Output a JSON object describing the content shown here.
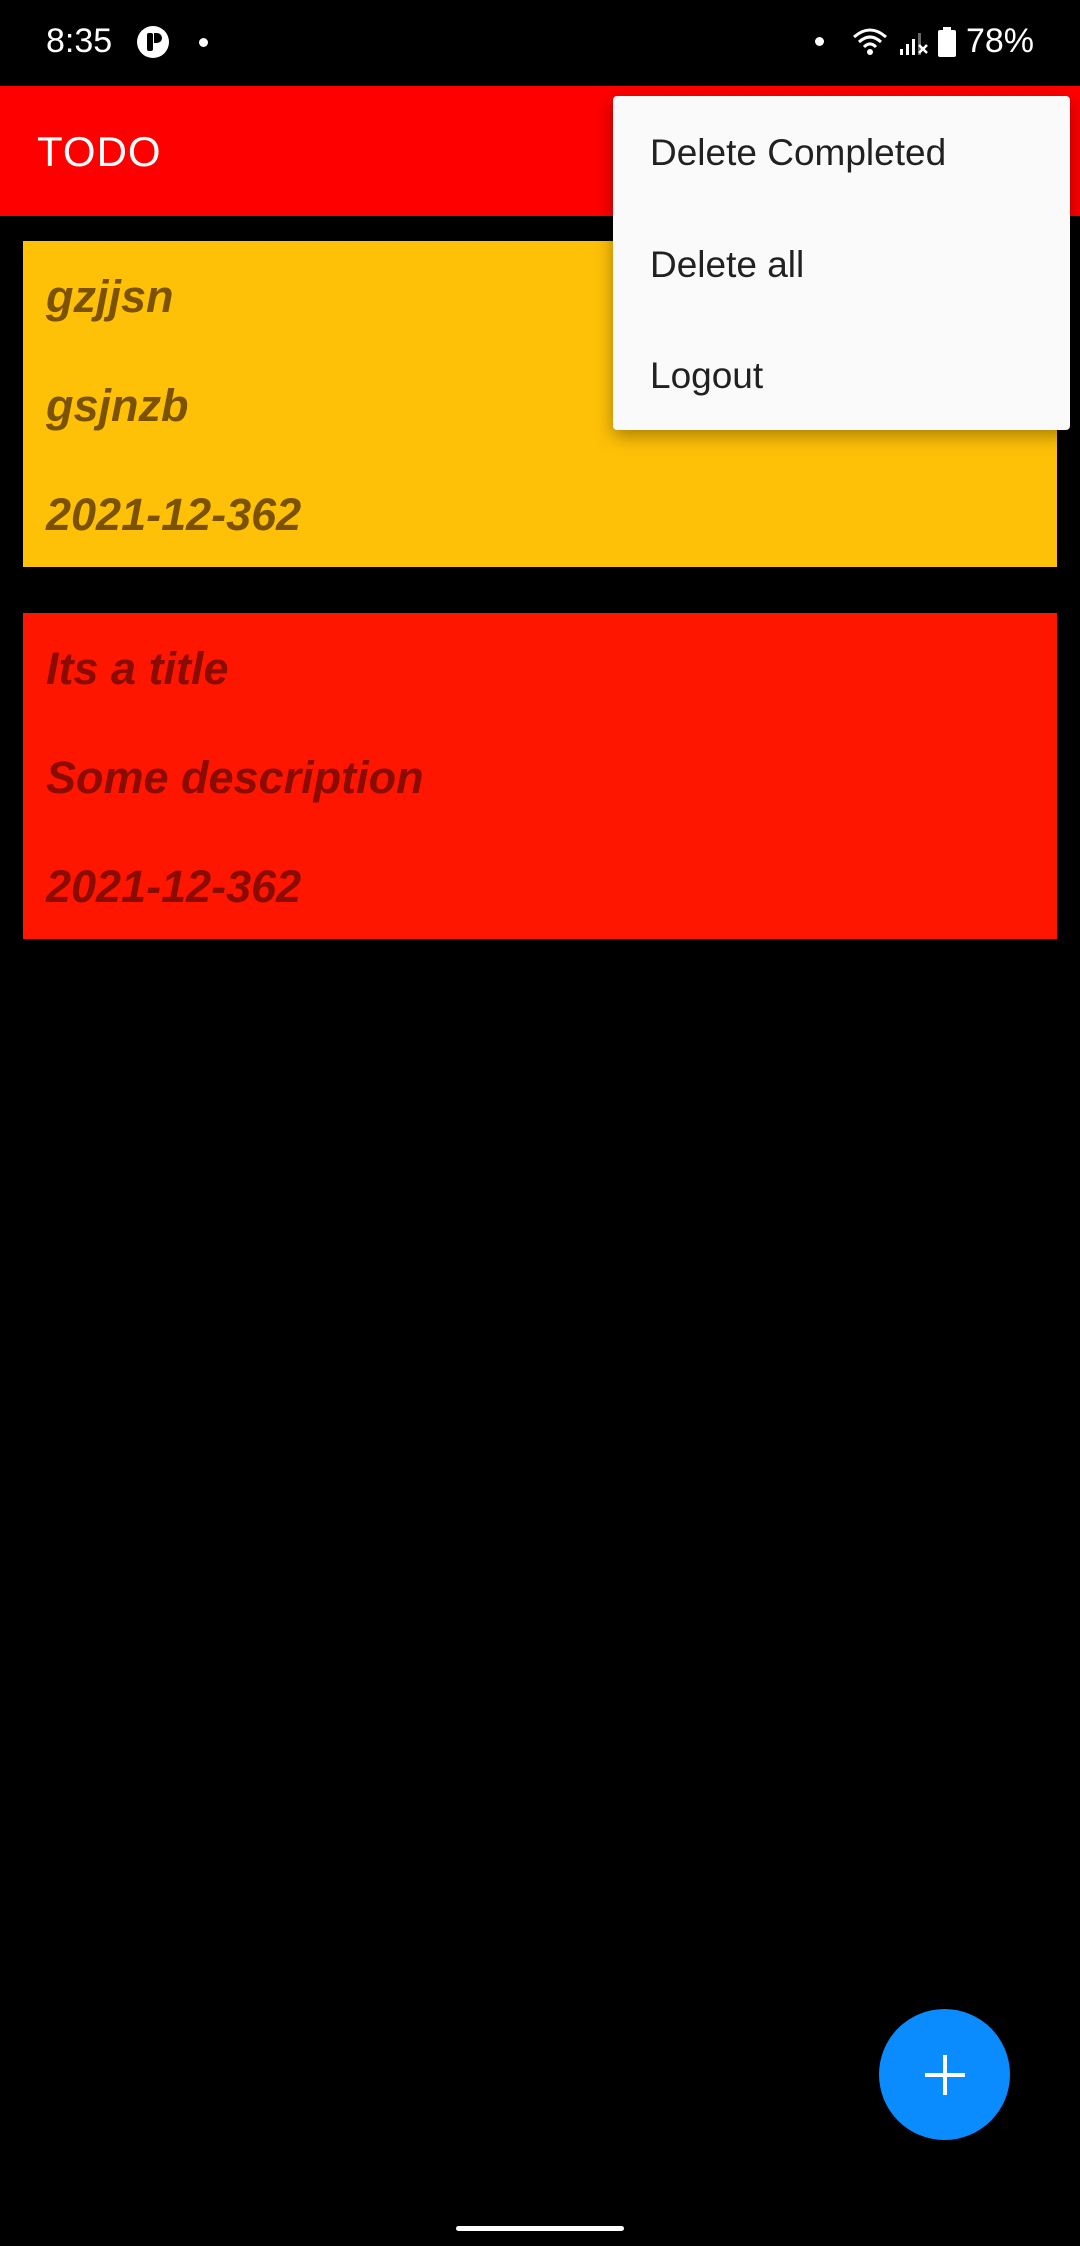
{
  "status_bar": {
    "time": "8:35",
    "battery": "78%",
    "icons": [
      "app-notification-icon",
      "dot-icon",
      "wifi-icon",
      "signal-icon",
      "battery-icon"
    ]
  },
  "app_bar": {
    "title": "TODO",
    "color": "#ff0000"
  },
  "todos": [
    {
      "title": "gzjjsn",
      "description": "gsjnzb",
      "date": "2021-12-362",
      "color": "#ffc107",
      "text_color": "#7a5200"
    },
    {
      "title": "Its a title",
      "description": "Some description",
      "date": "2021-12-362",
      "color": "#ff1600",
      "text_color": "#8a0c00"
    }
  ],
  "overflow_menu": {
    "items": [
      "Delete Completed",
      "Delete all",
      "Logout"
    ]
  },
  "fab": {
    "icon": "plus-icon",
    "color": "#0a8cff"
  }
}
